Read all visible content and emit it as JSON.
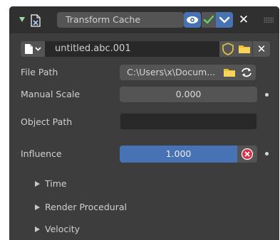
{
  "modifier": {
    "name": "Transform Cache",
    "icons": {
      "expand": "triangle-down-icon",
      "type": "constraint-cache-icon",
      "viewport": "eye-icon",
      "render_check": "check-icon",
      "editmode": "chevron-down-icon",
      "close": "close-icon",
      "drag": "grip-dots-icon"
    },
    "close_label": "✕"
  },
  "cache_file": {
    "name": "untitled.abc.001",
    "remove_label": "✕",
    "icons": {
      "file": "document-icon",
      "shield": "shield-icon",
      "folder": "folder-icon",
      "dropdown": "chevron-down-icon"
    }
  },
  "properties": {
    "file_path": {
      "label": "File Path",
      "value": "C:\\Users\\x\\Docum..."
    },
    "manual_scale": {
      "label": "Manual Scale",
      "value": "0.000"
    },
    "object_path": {
      "label": "Object Path",
      "value": ""
    },
    "influence": {
      "label": "Influence",
      "value": "1.000"
    }
  },
  "subpanels": [
    {
      "label": "Time"
    },
    {
      "label": "Render Procedural"
    },
    {
      "label": "Velocity"
    }
  ],
  "colors": {
    "panel_bg": "#3d3d3d",
    "header_bg": "#303030",
    "accent_blue": "#4772b3",
    "check_green": "#5fd35f",
    "folder_yellow": "#f0c030",
    "clear_red": "#d9314a"
  }
}
